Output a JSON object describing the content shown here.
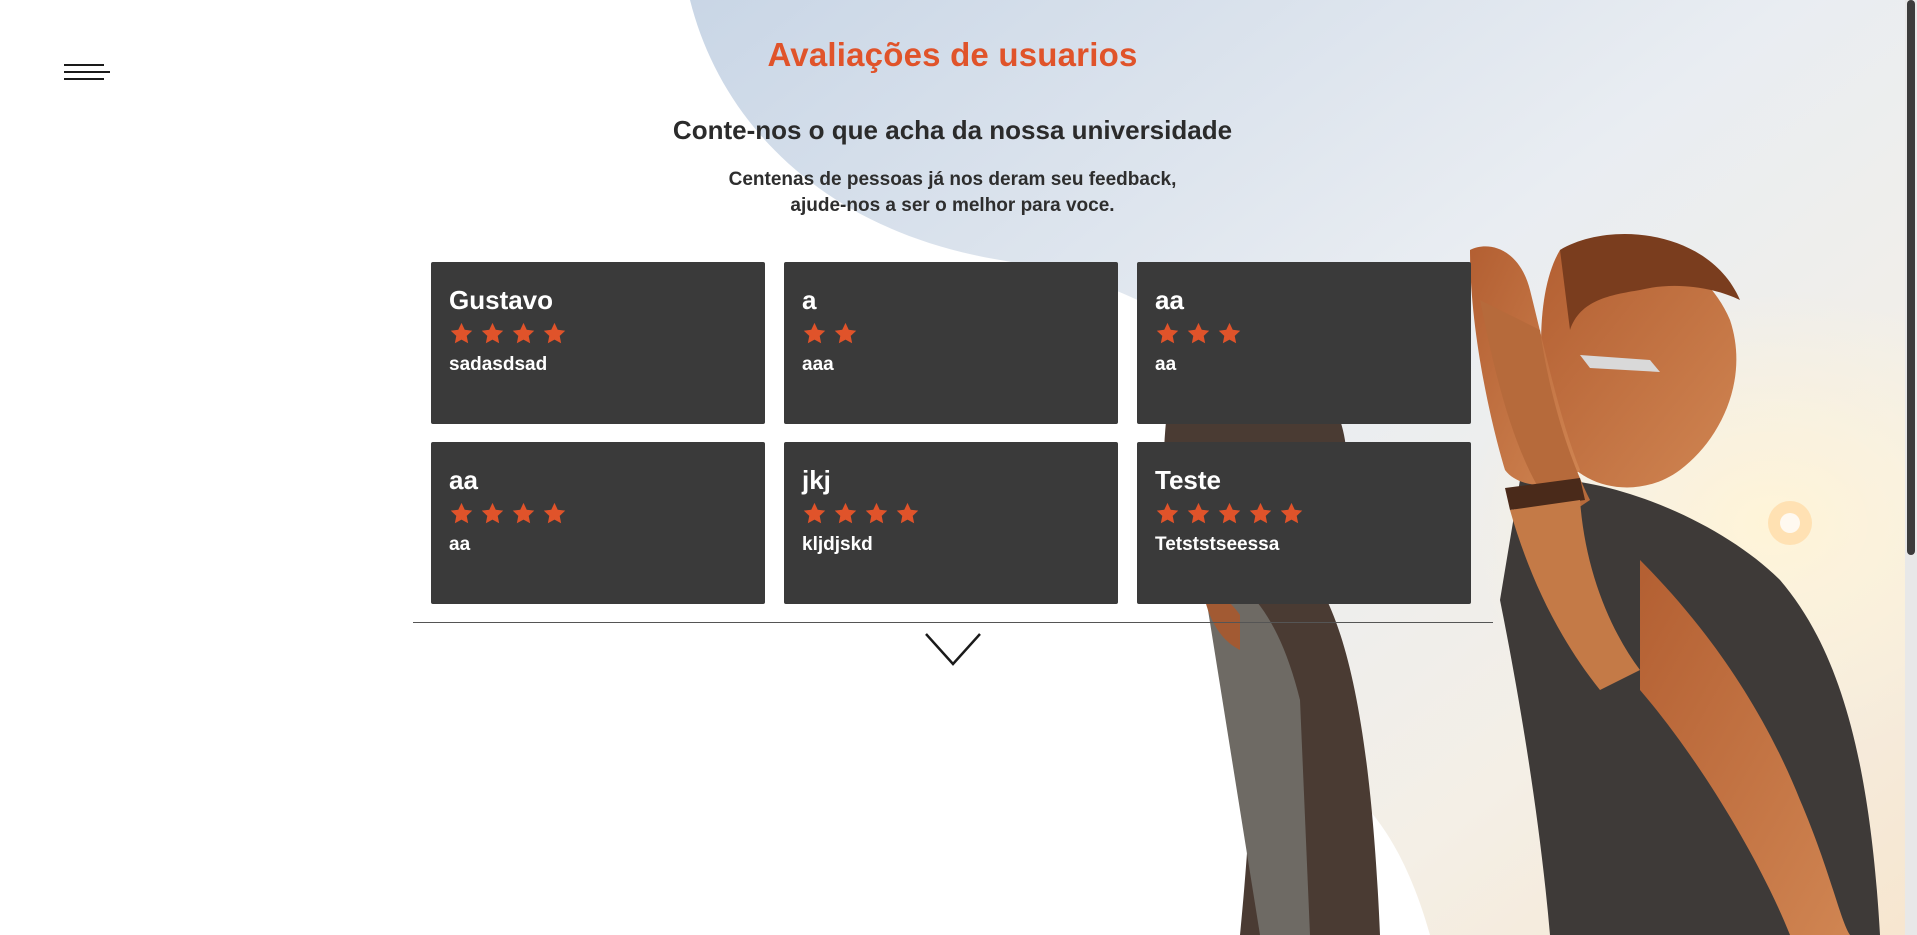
{
  "header": {
    "title": "Avaliações de usuarios",
    "subtitle": "Conte-nos o que acha da nossa universidade",
    "description_line1": "Centenas de pessoas já nos deram seu feedback,",
    "description_line2": "ajude-nos a ser o melhor para voce."
  },
  "menu": {
    "icon": "hamburger-menu-icon"
  },
  "reviews": [
    {
      "name": "Gustavo",
      "rating": 4,
      "comment": "sadasdsad"
    },
    {
      "name": "a",
      "rating": 2,
      "comment": "aaa"
    },
    {
      "name": "aa",
      "rating": 3,
      "comment": "aa"
    },
    {
      "name": "aa",
      "rating": 4,
      "comment": "aa"
    },
    {
      "name": "jkj",
      "rating": 4,
      "comment": "kljdjskd"
    },
    {
      "name": "Teste",
      "rating": 5,
      "comment": "Tetststseessa"
    }
  ],
  "scroll_down": {
    "icon": "chevron-down-icon"
  },
  "colors": {
    "accent": "#e0532a",
    "card_bg": "#3a3a3a",
    "text_dark": "#2b2b2b",
    "star": "#e0532a"
  }
}
